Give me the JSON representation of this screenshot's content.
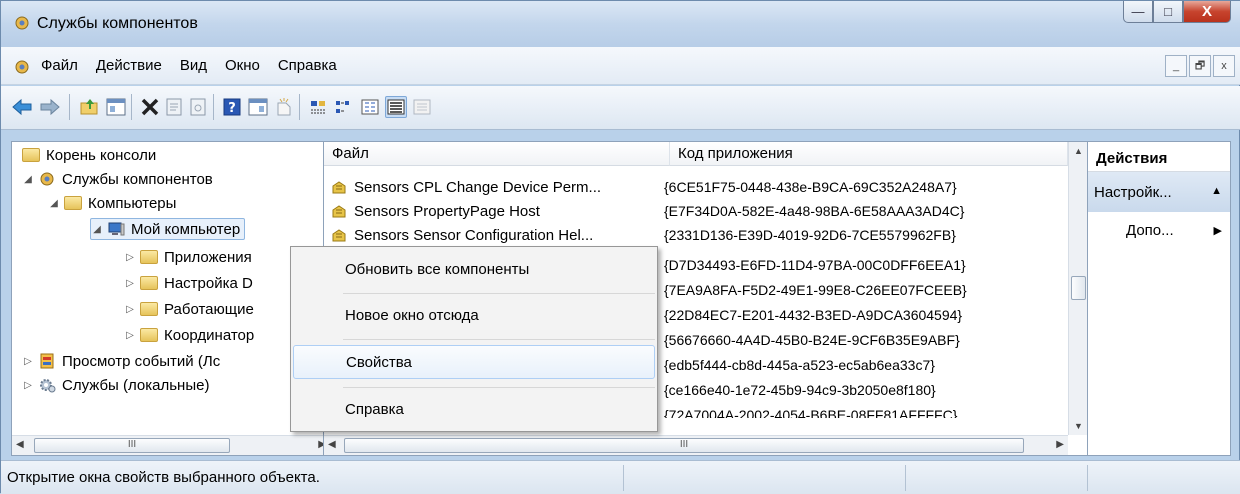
{
  "window": {
    "title": "Службы компонентов",
    "controls": {
      "minimize": "—",
      "maximize": "□",
      "close": "X"
    }
  },
  "menu": {
    "items": [
      "Файл",
      "Действие",
      "Вид",
      "Окно",
      "Справка"
    ],
    "mdi": {
      "minimize": "_",
      "restore": "🗗",
      "close": "x"
    }
  },
  "tree": {
    "items": [
      {
        "label": "Корень консоли",
        "expander": ""
      },
      {
        "label": "Службы компонентов",
        "expander": "◢"
      },
      {
        "label": "Компьютеры",
        "expander": "◢"
      },
      {
        "label": "Мой компьютер",
        "expander": "◢"
      },
      {
        "label": "Приложения",
        "expander": "▷"
      },
      {
        "label": "Настройка D",
        "expander": "▷"
      },
      {
        "label": "Работающие",
        "expander": "▷"
      },
      {
        "label": "Координатор",
        "expander": "▷"
      },
      {
        "label": "Просмотр событий (Лс",
        "expander": "▷"
      },
      {
        "label": "Службы (локальные)",
        "expander": "▷"
      }
    ],
    "scroll": {
      "left": "◀",
      "right": "▶",
      "grip": "III"
    }
  },
  "list": {
    "columns": {
      "file": "Файл",
      "app_id": "Код приложения"
    },
    "rows": [
      {
        "file": "Sensors CPL Change Device Perm...",
        "app_id": "{6CE51F75-0448-438e-B9CA-69C352A248A7}"
      },
      {
        "file": "Sensors PropertyPage Host",
        "app_id": "{E7F34D0A-582E-4a48-98BA-6E58AAA3AD4C}"
      },
      {
        "file": "Sensors Sensor Configuration Hel...",
        "app_id": "{2331D136-E39D-4019-92D6-7CE5579962FB}"
      },
      {
        "file": "",
        "app_id": "{D7D34493-E6FD-11D4-97BA-00C0DFF6EEA1}"
      },
      {
        "file": "",
        "app_id": "{7EA9A8FA-F5D2-49E1-99E8-C26EE07FCEEB}"
      },
      {
        "file": "",
        "app_id": "{22D84EC7-E201-4432-B3ED-A9DCA3604594}"
      },
      {
        "file": "",
        "app_id": "{56676660-4A4D-45B0-B24E-9CF6B35E9ABF}"
      },
      {
        "file": "",
        "app_id": "{edb5f444-cb8d-445a-a523-ec5ab6ea33c7}"
      },
      {
        "file": "",
        "app_id": "{ce166e40-1e72-45b9-94c9-3b2050e8f180}"
      },
      {
        "file": "",
        "app_id": "{72A7004A-2002-4054-B6BE-08FF81AFFFFC}"
      }
    ],
    "scroll": {
      "up": "▲",
      "down": "▼",
      "left": "◀",
      "right": "▶",
      "grip": "III"
    }
  },
  "actions": {
    "header": "Действия",
    "group": "Настройк...",
    "group_arrow": "▲",
    "more": "Допо...",
    "more_arrow": "▶"
  },
  "context_menu": {
    "items": [
      "Обновить все компоненты",
      "Новое окно отсюда",
      "Свойства",
      "Справка"
    ],
    "highlighted": "Свойства"
  },
  "status": {
    "text": "Открытие окна свойств выбранного объекта."
  },
  "colors": {
    "titlebar": "#c3d6ec",
    "close": "#c7442e",
    "highlight": "#e8f1fb",
    "folder": "#e6c35a"
  }
}
